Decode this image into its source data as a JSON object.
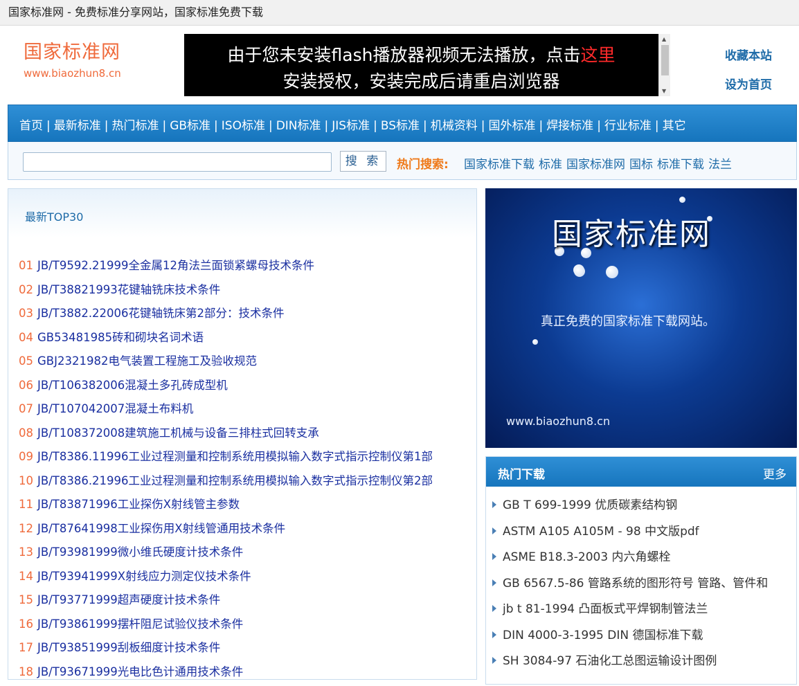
{
  "window": {
    "title": "国家标准网 - 免费标准分享网站，国家标准免费下载"
  },
  "header": {
    "logo_title": "国家标准网",
    "logo_url": "www.biaozhun8.cn",
    "flash_line1": "由于您未安装flash播放器视频无法播放，点击",
    "flash_link": "这里",
    "flash_line2": "安装授权，安装完成后请重启浏览器",
    "favorite": "收藏本站",
    "set_home": "设为首页"
  },
  "nav": {
    "items": [
      "首页",
      "最新标准",
      "热门标准",
      "GB标准",
      "ISO标准",
      "DIN标准",
      "JIS标准",
      "BS标准",
      "机械资料",
      "国外标准",
      "焊接标准",
      "行业标准",
      "其它"
    ],
    "separator": "|"
  },
  "search": {
    "button": "搜 索",
    "hot_label": "热门搜索:",
    "hot_terms": [
      "国家标准下载",
      "标准",
      "国家标准网",
      "国标",
      "标准下载",
      "法兰"
    ]
  },
  "latest": {
    "title": "最新TOP30",
    "items": [
      {
        "num": "01",
        "text": "JB/T9592.21999全金属12角法兰面锁紧螺母技术条件"
      },
      {
        "num": "02",
        "text": "JB/T38821993花键轴铣床技术条件"
      },
      {
        "num": "03",
        "text": "JB/T3882.22006花键轴铣床第2部分：技术条件"
      },
      {
        "num": "04",
        "text": "GB53481985砖和砌块名词术语"
      },
      {
        "num": "05",
        "text": "GBJ2321982电气装置工程施工及验收规范"
      },
      {
        "num": "06",
        "text": "JB/T106382006混凝土多孔砖成型机"
      },
      {
        "num": "07",
        "text": "JB/T107042007混凝土布料机"
      },
      {
        "num": "08",
        "text": "JB/T108372008建筑施工机械与设备三排柱式回转支承"
      },
      {
        "num": "09",
        "text": "JB/T8386.11996工业过程测量和控制系统用模拟输入数字式指示控制仪第1部"
      },
      {
        "num": "10",
        "text": "JB/T8386.21996工业过程测量和控制系统用模拟输入数字式指示控制仪第2部"
      },
      {
        "num": "11",
        "text": "JB/T83871996工业探伤X射线管主参数"
      },
      {
        "num": "12",
        "text": "JB/T87641998工业探伤用X射线管通用技术条件"
      },
      {
        "num": "13",
        "text": "JB/T93981999微小维氏硬度计技术条件"
      },
      {
        "num": "14",
        "text": "JB/T93941999X射线应力测定仪技术条件"
      },
      {
        "num": "15",
        "text": "JB/T93771999超声硬度计技术条件"
      },
      {
        "num": "16",
        "text": "JB/T93861999摆杆阻尼试验仪技术条件"
      },
      {
        "num": "17",
        "text": "JB/T93851999刮板细度计技术条件"
      },
      {
        "num": "18",
        "text": "JB/T93671999光电比色计通用技术条件"
      }
    ]
  },
  "banner": {
    "title": "国家标准网",
    "slogan": "真正免费的国家标准下载网站。",
    "url": "www.biaozhun8.cn"
  },
  "hot_downloads": {
    "title": "热门下载",
    "more": "更多",
    "items": [
      "GB T 699-1999 优质碳素结构钢",
      "ASTM A105 A105M - 98 中文版pdf",
      "ASME B18.3-2003 内六角螺栓",
      "GB 6567.5-86 管路系统的图形符号 管路、管件和",
      "jb t 81-1994 凸面板式平焊钢制管法兰",
      "DIN 4000-3-1995 DIN 德国标准下载",
      "SH 3084-97 石油化工总图运输设计图例"
    ]
  },
  "colors": {
    "brand_orange": "#ef6a3b",
    "nav_blue": "#1e7fc8",
    "link_blue": "#1a2fa0"
  }
}
